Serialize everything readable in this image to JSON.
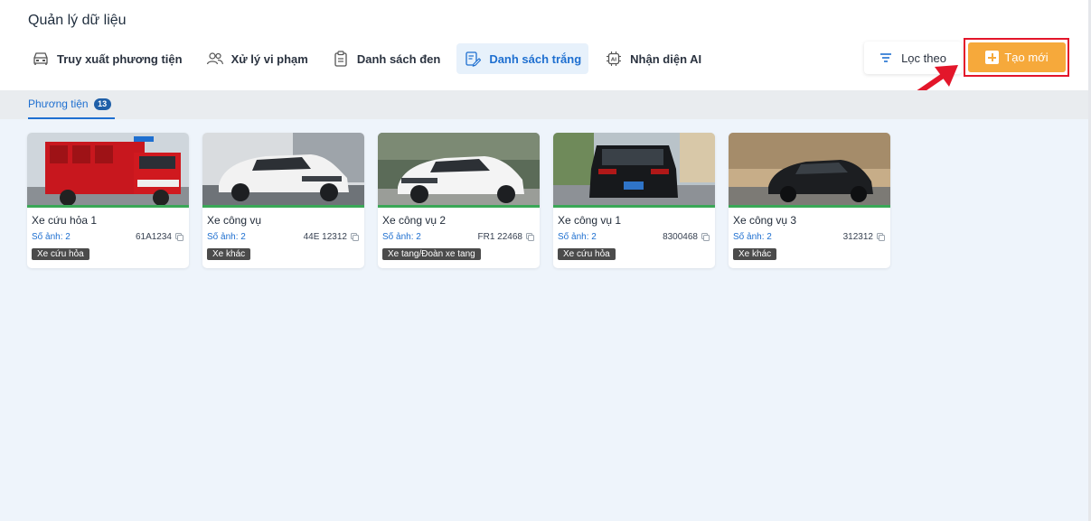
{
  "page": {
    "title": "Quản lý dữ liệu"
  },
  "nav": {
    "tabs": [
      {
        "label": "Truy xuất phương tiện",
        "icon": "car-icon",
        "active": false
      },
      {
        "label": "Xử lý vi phạm",
        "icon": "users-icon",
        "active": false
      },
      {
        "label": "Danh sách đen",
        "icon": "clipboard-icon",
        "active": false
      },
      {
        "label": "Danh sách trắng",
        "icon": "edit-list-icon",
        "active": true
      },
      {
        "label": "Nhận diện AI",
        "icon": "ai-chip-icon",
        "active": false
      }
    ]
  },
  "toolbar": {
    "filter_label": "Lọc theo",
    "create_label": "Tạo mới"
  },
  "subtab": {
    "label": "Phương tiện",
    "count": "13"
  },
  "vehicles": [
    {
      "name": "Xe cứu hỏa 1",
      "images_label": "Số ảnh: 2",
      "plate": "61A1234",
      "tag": "Xe cứu hỏa"
    },
    {
      "name": "Xe công vụ",
      "images_label": "Số ảnh: 2",
      "plate": "44E 12312",
      "tag": "Xe khác"
    },
    {
      "name": "Xe công vụ 2",
      "images_label": "Số ảnh: 2",
      "plate": "FR1 22468",
      "tag": "Xe tang/Đoàn xe tang"
    },
    {
      "name": "Xe công vụ 1",
      "images_label": "Số ảnh: 2",
      "plate": "8300468",
      "tag": "Xe cứu hỏa"
    },
    {
      "name": "Xe công vụ 3",
      "images_label": "Số ảnh: 2",
      "plate": "312312",
      "tag": "Xe khác"
    }
  ],
  "colors": {
    "accent": "#1e6fd0",
    "create_button": "#f6a93b",
    "highlight": "#e3162a"
  }
}
